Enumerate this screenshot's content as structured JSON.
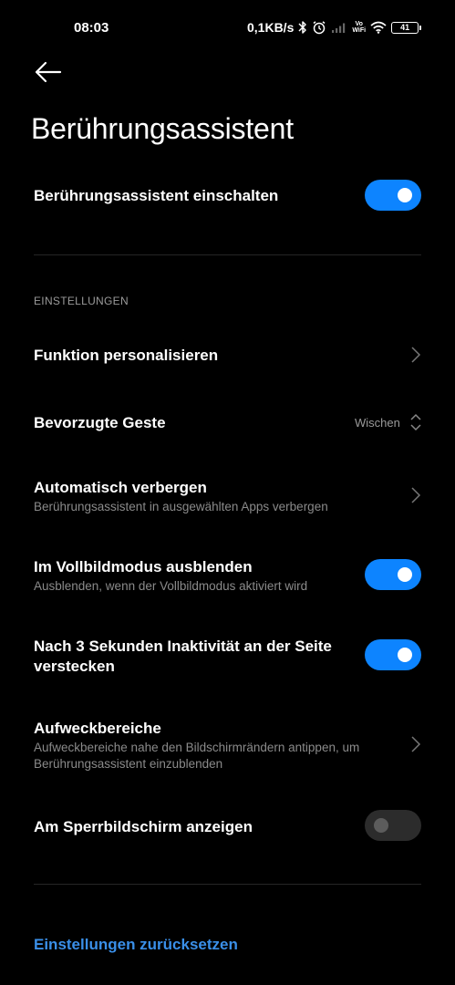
{
  "status_bar": {
    "time": "08:03",
    "net_speed": "0,1KB/s",
    "vowifi_top": "Vo",
    "vowifi_bottom": "WiFi",
    "battery": "41"
  },
  "header": {
    "title": "Berührungsassistent"
  },
  "main_toggle": {
    "label": "Berührungsassistent einschalten",
    "enabled": true
  },
  "settings": {
    "section_label": "EINSTELLUNGEN",
    "items": [
      {
        "title": "Funktion personalisieren",
        "type": "chevron"
      },
      {
        "title": "Bevorzugte Geste",
        "value": "Wischen",
        "type": "select"
      },
      {
        "title": "Automatisch verbergen",
        "subtitle": "Berührungsassistent in ausgewählten Apps verbergen",
        "type": "chevron"
      },
      {
        "title": "Im Vollbildmodus ausblenden",
        "subtitle": "Ausblenden, wenn der Vollbildmodus aktiviert wird",
        "type": "toggle",
        "enabled": true
      },
      {
        "title": "Nach 3 Sekunden Inaktivität an der Seite verstecken",
        "type": "toggle",
        "enabled": true
      },
      {
        "title": "Aufweckbereiche",
        "subtitle": "Aufweckbereiche nahe den Bildschirmrändern antippen, um Berührungsassistent einzublenden",
        "type": "chevron"
      },
      {
        "title": "Am Sperrbildschirm anzeigen",
        "type": "toggle",
        "enabled": false
      }
    ]
  },
  "reset_link": "Einstellungen zurücksetzen",
  "colors": {
    "background": "#000000",
    "accent": "#0d84ff",
    "link": "#3a8fe8",
    "secondary_text": "#8a8a8a"
  }
}
